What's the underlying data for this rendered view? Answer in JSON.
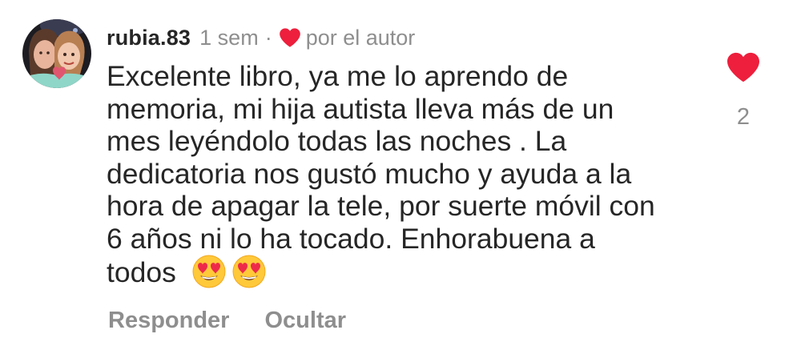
{
  "comment": {
    "username": "rubia.83",
    "timestamp": "1 sem",
    "separator": "·",
    "liked_by_author_label": "por el autor",
    "text_lines": [
      "Excelente libro, ya me lo aprendo de",
      "memoria, mi hija autista lleva más de un",
      "mes leyéndolo todas las noches . La",
      "dedicatoria nos gustó mucho y ayuda a la",
      "hora de apagar la tele, por suerte móvil con",
      "6 años ni lo ha tocado. Enhorabuena a",
      "todos"
    ],
    "emojis": [
      "heart-eyes-emoji",
      "heart-eyes-emoji"
    ],
    "like_count": "2",
    "actions": {
      "reply_label": "Responder",
      "hide_label": "Ocultar"
    }
  },
  "colors": {
    "heart_red": "#ed1f3c",
    "secondary_text": "#8e8e8e",
    "primary_text": "#262626"
  },
  "icons": {
    "author_heart": "heart-icon",
    "like": "heart-icon"
  }
}
